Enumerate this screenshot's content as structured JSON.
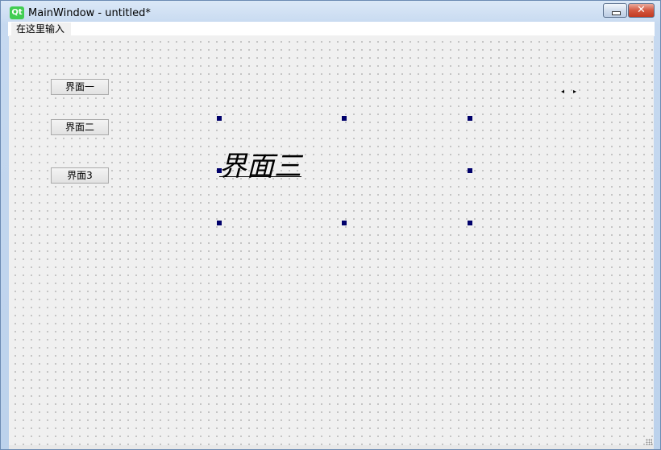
{
  "window": {
    "title": "MainWindow - untitled*",
    "logo_text": "Qt",
    "minimize_glyph": "",
    "close_glyph": "✕"
  },
  "menubar": {
    "items": [
      {
        "label": "在这里输入"
      }
    ]
  },
  "form": {
    "buttons": [
      {
        "label": "界面一"
      },
      {
        "label": "界面二"
      },
      {
        "label": "界面3"
      }
    ],
    "selected_label": {
      "text": "界面三"
    },
    "spacer_arrows": {
      "left": "◂",
      "right": "▸"
    }
  },
  "colors": {
    "selection_handle": "#00006b",
    "close_button": "#c13a22",
    "qt_logo": "#41cd52"
  }
}
